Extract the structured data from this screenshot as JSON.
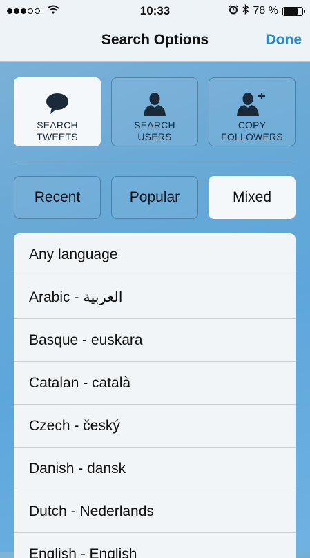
{
  "status_bar": {
    "time": "10:33",
    "battery_text": "78 %",
    "battery_level": 0.78,
    "signal_bars": 3,
    "signal_total": 5,
    "icons": [
      "wifi-icon",
      "alarm-icon",
      "bluetooth-icon",
      "battery-icon"
    ]
  },
  "nav": {
    "title": "Search Options",
    "done_label": "Done",
    "done_color": "#1e88e5"
  },
  "modes": [
    {
      "label": "SEARCH\nTWEETS",
      "icon": "speech-bubble-icon",
      "active": true
    },
    {
      "label": "SEARCH\nUSERS",
      "icon": "user-icon",
      "active": false
    },
    {
      "label": "COPY\nFOLLOWERS",
      "icon": "add-user-icon",
      "active": false
    }
  ],
  "sort": [
    {
      "label": "Recent",
      "active": false
    },
    {
      "label": "Popular",
      "active": false
    },
    {
      "label": "Mixed",
      "active": true
    }
  ],
  "languages": [
    "Any language",
    "Arabic - العربية",
    "Basque - euskara",
    "Catalan - català",
    "Czech - český",
    "Danish - dansk",
    "Dutch - Nederlands",
    "English - English"
  ]
}
